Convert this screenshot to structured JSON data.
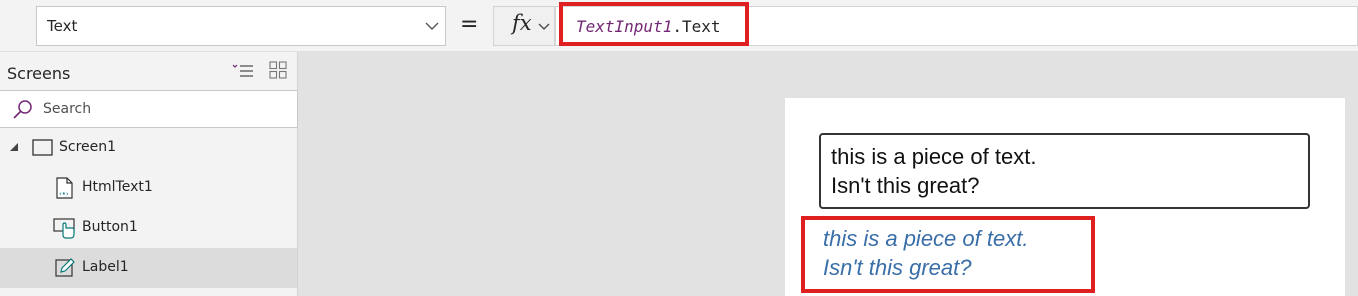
{
  "formula_bar": {
    "property": "Text",
    "equals": "=",
    "fx_label": "fx",
    "formula_identifier": "TextInput1",
    "formula_rest": ".Text"
  },
  "tree": {
    "title": "Screens",
    "search_placeholder": "Search",
    "items": [
      {
        "label": "Screen1",
        "icon": "screen-icon"
      },
      {
        "label": "HtmlText1",
        "icon": "html-text-icon"
      },
      {
        "label": "Button1",
        "icon": "button-icon"
      },
      {
        "label": "Label1",
        "icon": "label-icon"
      }
    ]
  },
  "canvas": {
    "text_input": {
      "line1": "this is a piece of text.",
      "line2": "Isn't this great?"
    },
    "html_text": {
      "line1": "this is a piece of text.",
      "line2": "Isn't this great?"
    }
  },
  "colors": {
    "highlight": "#e02020",
    "accent": "#742774",
    "html_text": "#3a6ea8"
  }
}
